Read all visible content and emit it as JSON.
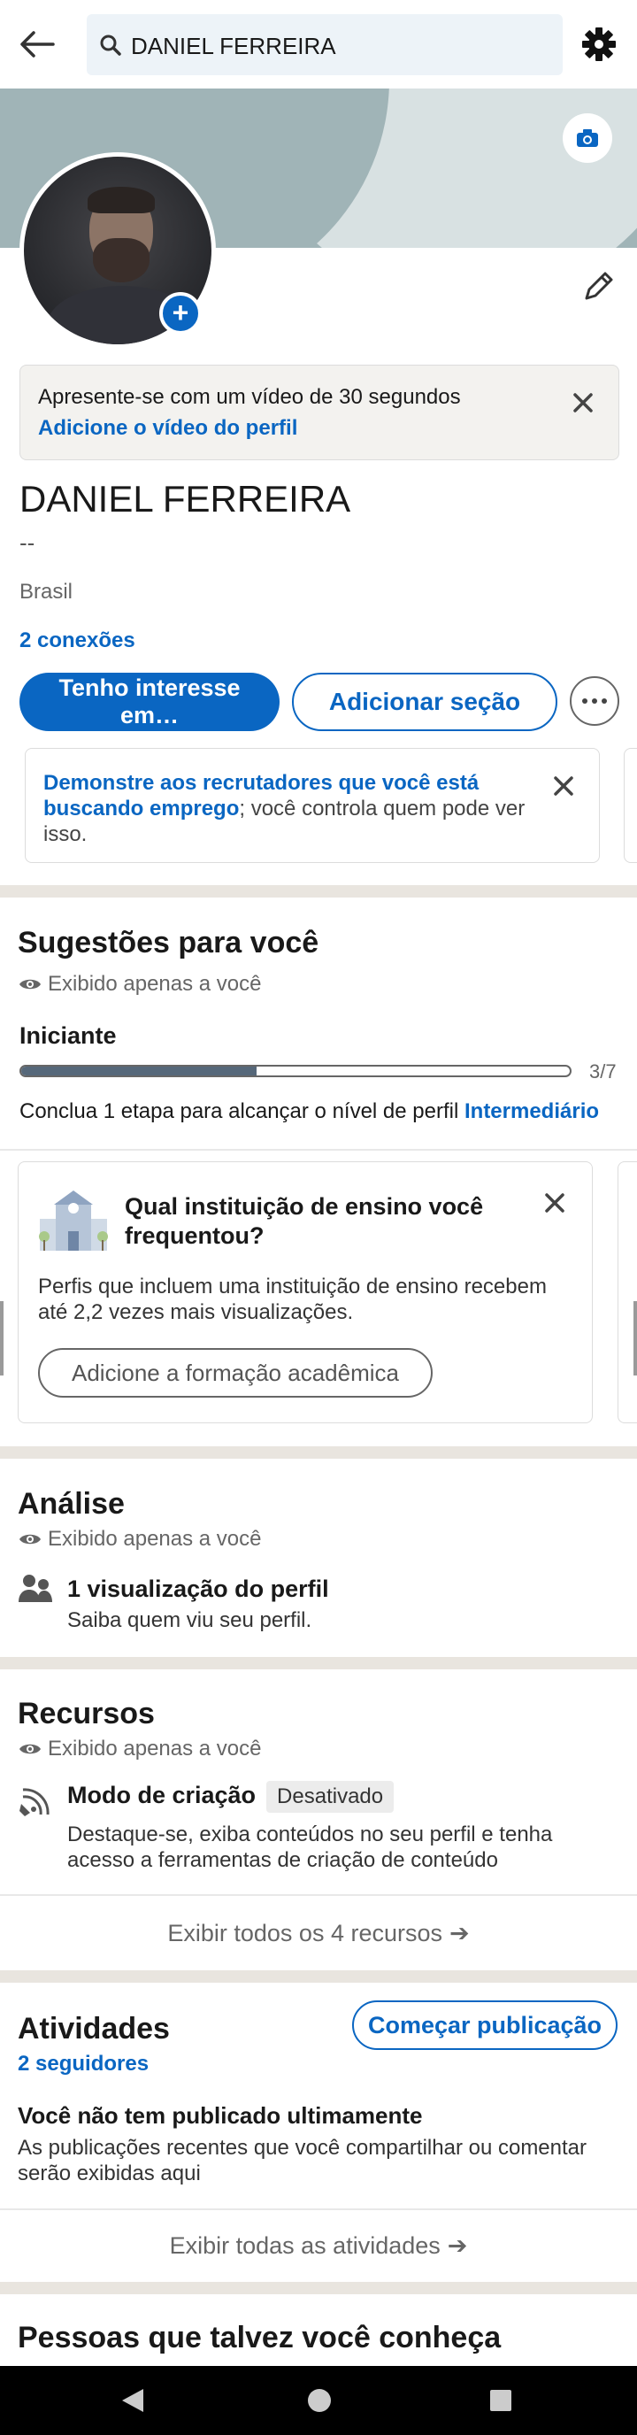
{
  "search": {
    "query": "DANIEL FERREIRA"
  },
  "icons": {
    "back": "arrow-left-icon",
    "search": "search-icon",
    "settings": "gear-icon",
    "camera": "camera-icon",
    "add": "plus-icon",
    "edit": "pencil-icon",
    "close": "close-icon",
    "more": "ellipsis-icon",
    "eye": "eye-icon",
    "people": "people-icon",
    "creator": "broadcast-icon",
    "school": "school-building-icon",
    "arrow": "arrow-right-icon"
  },
  "colors": {
    "accent": "#0a66c2",
    "divider": "#e9e5df",
    "progress": "#56687a"
  },
  "video_prompt": {
    "title": "Apresente-se com um vídeo de 30 segundos",
    "link": "Adicione o vídeo do perfil"
  },
  "profile": {
    "name": "DANIEL FERREIRA",
    "headline": "--",
    "location": "Brasil",
    "connections": "2 conexões",
    "add_plus": "+"
  },
  "actions": {
    "open_to_line1": "Tenho interesse",
    "open_to_line2": "em…",
    "add_section": "Adicionar seção"
  },
  "recruiter_card": {
    "link": "Demonstre aos recrutadores que você está buscando emprego",
    "rest": "; você controla quem pode ver isso."
  },
  "suggestions": {
    "title": "Sugestões para você",
    "private_note": "Exibido apenas a você",
    "level": "Iniciante",
    "progress": {
      "current": 3,
      "total": 7,
      "label": "3/7"
    },
    "hint_prefix": "Conclua 1 etapa para alcançar o nível de perfil ",
    "hint_level": "Intermediário",
    "education_card": {
      "title": "Qual instituição de ensino você frequentou?",
      "description": "Perfis que incluem uma instituição de ensino recebem até 2,2 vezes mais visualizações.",
      "button": "Adicione a formação acadêmica"
    }
  },
  "analytics": {
    "title": "Análise",
    "private_note": "Exibido apenas a você",
    "item_title": "1 visualização do perfil",
    "item_sub": "Saiba quem viu seu perfil."
  },
  "resources": {
    "title": "Recursos",
    "private_note": "Exibido apenas a você",
    "item_title": "Modo de criação",
    "item_badge": "Desativado",
    "item_sub": "Destaque-se, exiba conteúdos no seu perfil e tenha acesso a ferramentas de criação de conteúdo",
    "show_all": "Exibir todos os 4 recursos"
  },
  "activity": {
    "title": "Atividades",
    "start_post": "Começar publicação",
    "followers": "2 seguidores",
    "empty_title": "Você não tem publicado ultimamente",
    "empty_sub": "As publicações recentes que você compartilhar ou comentar serão exibidas aqui",
    "show_all": "Exibir todas as atividades"
  },
  "people": {
    "title": "Pessoas que talvez você conheça"
  }
}
